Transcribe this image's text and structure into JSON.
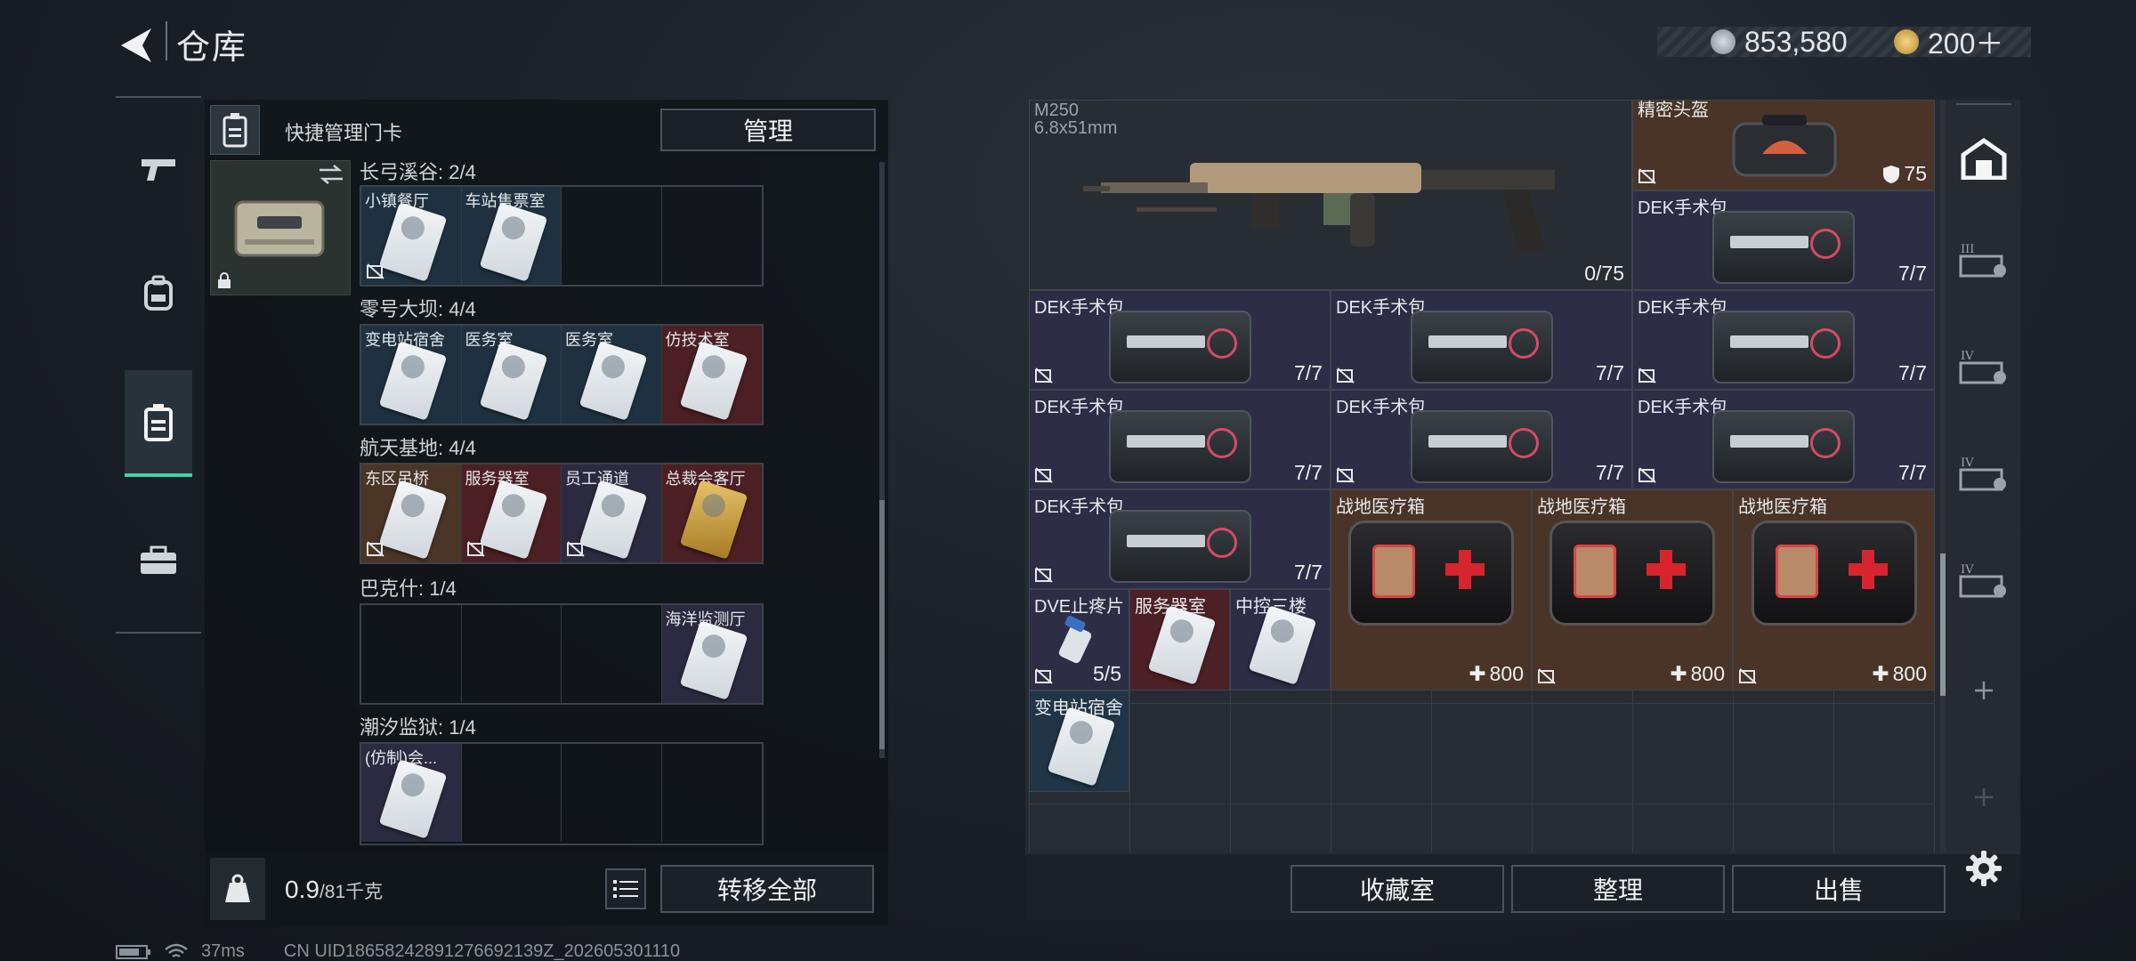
{
  "header": {
    "title": "仓库",
    "currency_silver": "853,580",
    "currency_gold": "200＋"
  },
  "left_panel": {
    "quick_label": "快捷管理门卡",
    "manage_button": "管理",
    "groups": [
      {
        "title": "长弓溪谷: 2/4",
        "cells": [
          {
            "name": "小镇餐厅",
            "color": "blue"
          },
          {
            "name": "车站售票室",
            "color": "blue"
          },
          {
            "name": "",
            "color": "empty"
          },
          {
            "name": "",
            "color": "empty"
          }
        ]
      },
      {
        "title": "零号大坝: 4/4",
        "cells": [
          {
            "name": "变电站宿舍",
            "color": "blue"
          },
          {
            "name": "医务室",
            "color": "blue"
          },
          {
            "name": "医务室",
            "color": "blue"
          },
          {
            "name": "仿技术室",
            "color": "red"
          }
        ]
      },
      {
        "title": "航天基地: 4/4",
        "cells": [
          {
            "name": "东区吊桥",
            "color": "brown"
          },
          {
            "name": "服务器室",
            "color": "red"
          },
          {
            "name": "员工通道",
            "color": "purple"
          },
          {
            "name": "总裁会客厅",
            "color": "red"
          }
        ]
      },
      {
        "title": "巴克什: 1/4",
        "cells": [
          {
            "name": "",
            "color": "empty"
          },
          {
            "name": "",
            "color": "empty"
          },
          {
            "name": "",
            "color": "empty"
          },
          {
            "name": "海洋监测厅",
            "color": "purple"
          }
        ]
      },
      {
        "title": "潮汐监狱: 1/4",
        "cells": [
          {
            "name": "(仿制)会...",
            "color": "purple"
          },
          {
            "name": "",
            "color": "empty"
          },
          {
            "name": "",
            "color": "empty"
          },
          {
            "name": "",
            "color": "empty"
          }
        ]
      }
    ],
    "weight_value": "0.9",
    "weight_max": "/81千克",
    "transfer_all_button": "转移全部"
  },
  "right_panel": {
    "weapon": {
      "name": "M250",
      "caliber": "6.8x51mm",
      "ammo": "0/75"
    },
    "precision_helmet": {
      "name": "精密头盔",
      "durability": "75"
    },
    "surgery_kits": [
      {
        "name": "DEK手术包",
        "count": "7/7"
      },
      {
        "name": "DEK手术包",
        "count": "7/7"
      },
      {
        "name": "DEK手术包",
        "count": "7/7"
      },
      {
        "name": "DEK手术包",
        "count": "7/7"
      },
      {
        "name": "DEK手术包",
        "count": "7/7"
      },
      {
        "name": "DEK手术包",
        "count": "7/7"
      },
      {
        "name": "DEK手术包",
        "count": "7/7"
      },
      {
        "name": "DEK手术包",
        "count": "7/7"
      }
    ],
    "medkits": [
      {
        "name": "战地医疗箱",
        "value": "800"
      },
      {
        "name": "战地医疗箱",
        "value": "800"
      },
      {
        "name": "战地医疗箱",
        "value": "800"
      }
    ],
    "painkiller": {
      "name": "DVE止疼片",
      "count": "5/5"
    },
    "server_room_card": "服务器室",
    "control_card": "中控三楼",
    "substation_card": "变电站宿舍",
    "buttons": {
      "collection": "收藏室",
      "sort": "整理",
      "sell": "出售"
    }
  },
  "status_bar": {
    "ping": "37ms",
    "uid": "CN UID18658242891276692139Z_202605301110"
  },
  "colors": {
    "accent": "#3fd3a1",
    "purple_rarity": "#2d2d46",
    "gold_rarity": "#4a3427",
    "red_rarity": "#4d2026",
    "blue_rarity": "#213547"
  }
}
